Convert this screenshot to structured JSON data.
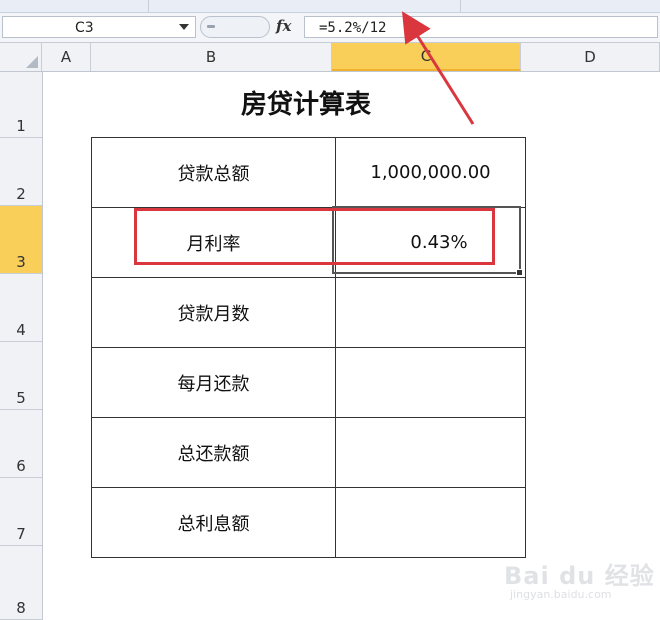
{
  "formula_bar": {
    "name_box": "C3",
    "fx_label": "fx",
    "formula": "=5.2%/12"
  },
  "columns": [
    "A",
    "B",
    "C",
    "D"
  ],
  "active_column": "C",
  "rows": [
    "1",
    "2",
    "3",
    "4",
    "5",
    "6",
    "7",
    "8"
  ],
  "active_row": "3",
  "sheet": {
    "title": "房贷计算表",
    "table": [
      {
        "label": "贷款总额",
        "value": "1,000,000.00"
      },
      {
        "label": "月利率",
        "value": "0.43%"
      },
      {
        "label": "贷款月数",
        "value": ""
      },
      {
        "label": "每月还款",
        "value": ""
      },
      {
        "label": "总还款额",
        "value": ""
      },
      {
        "label": "总利息额",
        "value": ""
      }
    ]
  },
  "annotation_color": "#d9363e",
  "header_highlight_color": "#f9cf5a",
  "watermark": {
    "logo": "Bai du 经验",
    "url": "jingyan.baidu.com"
  }
}
